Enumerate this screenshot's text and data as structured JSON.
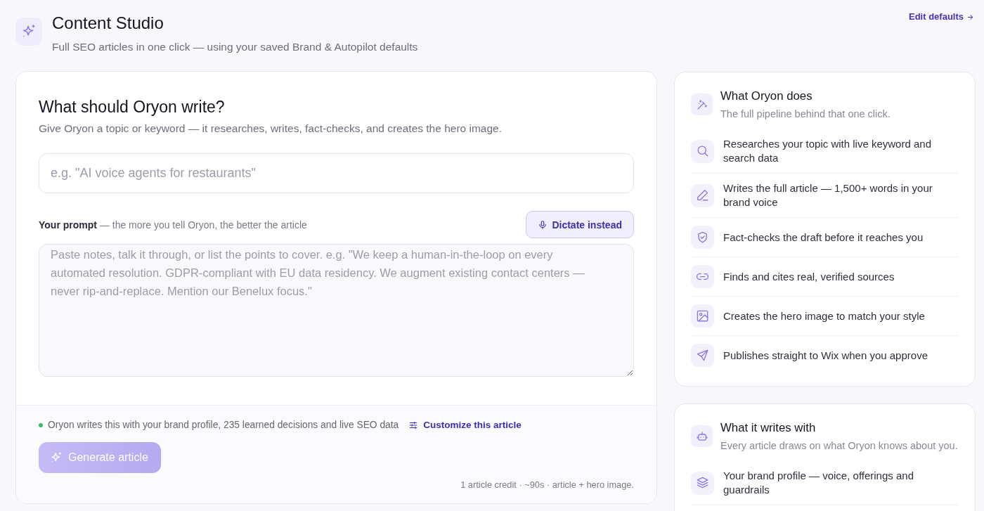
{
  "header": {
    "title": "Content Studio",
    "subtitle": "Full SEO articles in one click — using your saved Brand & Autopilot defaults",
    "edit_link": "Edit defaults"
  },
  "composer": {
    "heading": "What should Oryon write?",
    "description": "Give Oryon a topic or keyword — it researches, writes, fact-checks, and creates the hero image.",
    "topic_field": {
      "placeholder": "e.g. \"AI voice agents for restaurants\""
    },
    "prompt_label": "**Your prompt** — the more you tell Oryon, the better the article",
    "dictate_button": "Dictate instead",
    "prompt_field": {
      "placeholder": "Paste notes, talk it through, or list the points to cover. e.g. \"We keep a human-in-the-loop on every automated resolution. GDPR-compliant with EU data residency. We augment existing contact centers — never rip-and-replace. Mention our Benelux focus.\""
    },
    "footer": {
      "status": "Oryon writes this with your brand profile, 235 learned decisions and live SEO data",
      "customize_link": "Customize this article",
      "generate_button": {
        "label": "Generate article",
        "disabled": true
      },
      "cost_note": "1 article credit · ~90s · article + hero image."
    }
  },
  "panels": [
    {
      "title": "What Oryon does",
      "subtitle": "The full pipeline behind that one click.",
      "items": [
        {
          "text": "Researches your topic with live keyword and search data"
        },
        {
          "text": "Writes the full article — 1,500+ words in your brand voice"
        },
        {
          "text": "Fact-checks the draft before it reaches you"
        },
        {
          "text": "Finds and cites real, verified sources"
        },
        {
          "text": "Creates the hero image to match your style"
        },
        {
          "text": "Publishes straight to Wix when you approve"
        }
      ]
    },
    {
      "title": "What it writes with",
      "subtitle": "Every article draws on what Oryon knows about you.",
      "items": [
        {
          "text": "Your brand profile — voice, offerings and guardrails"
        }
      ]
    }
  ]
}
